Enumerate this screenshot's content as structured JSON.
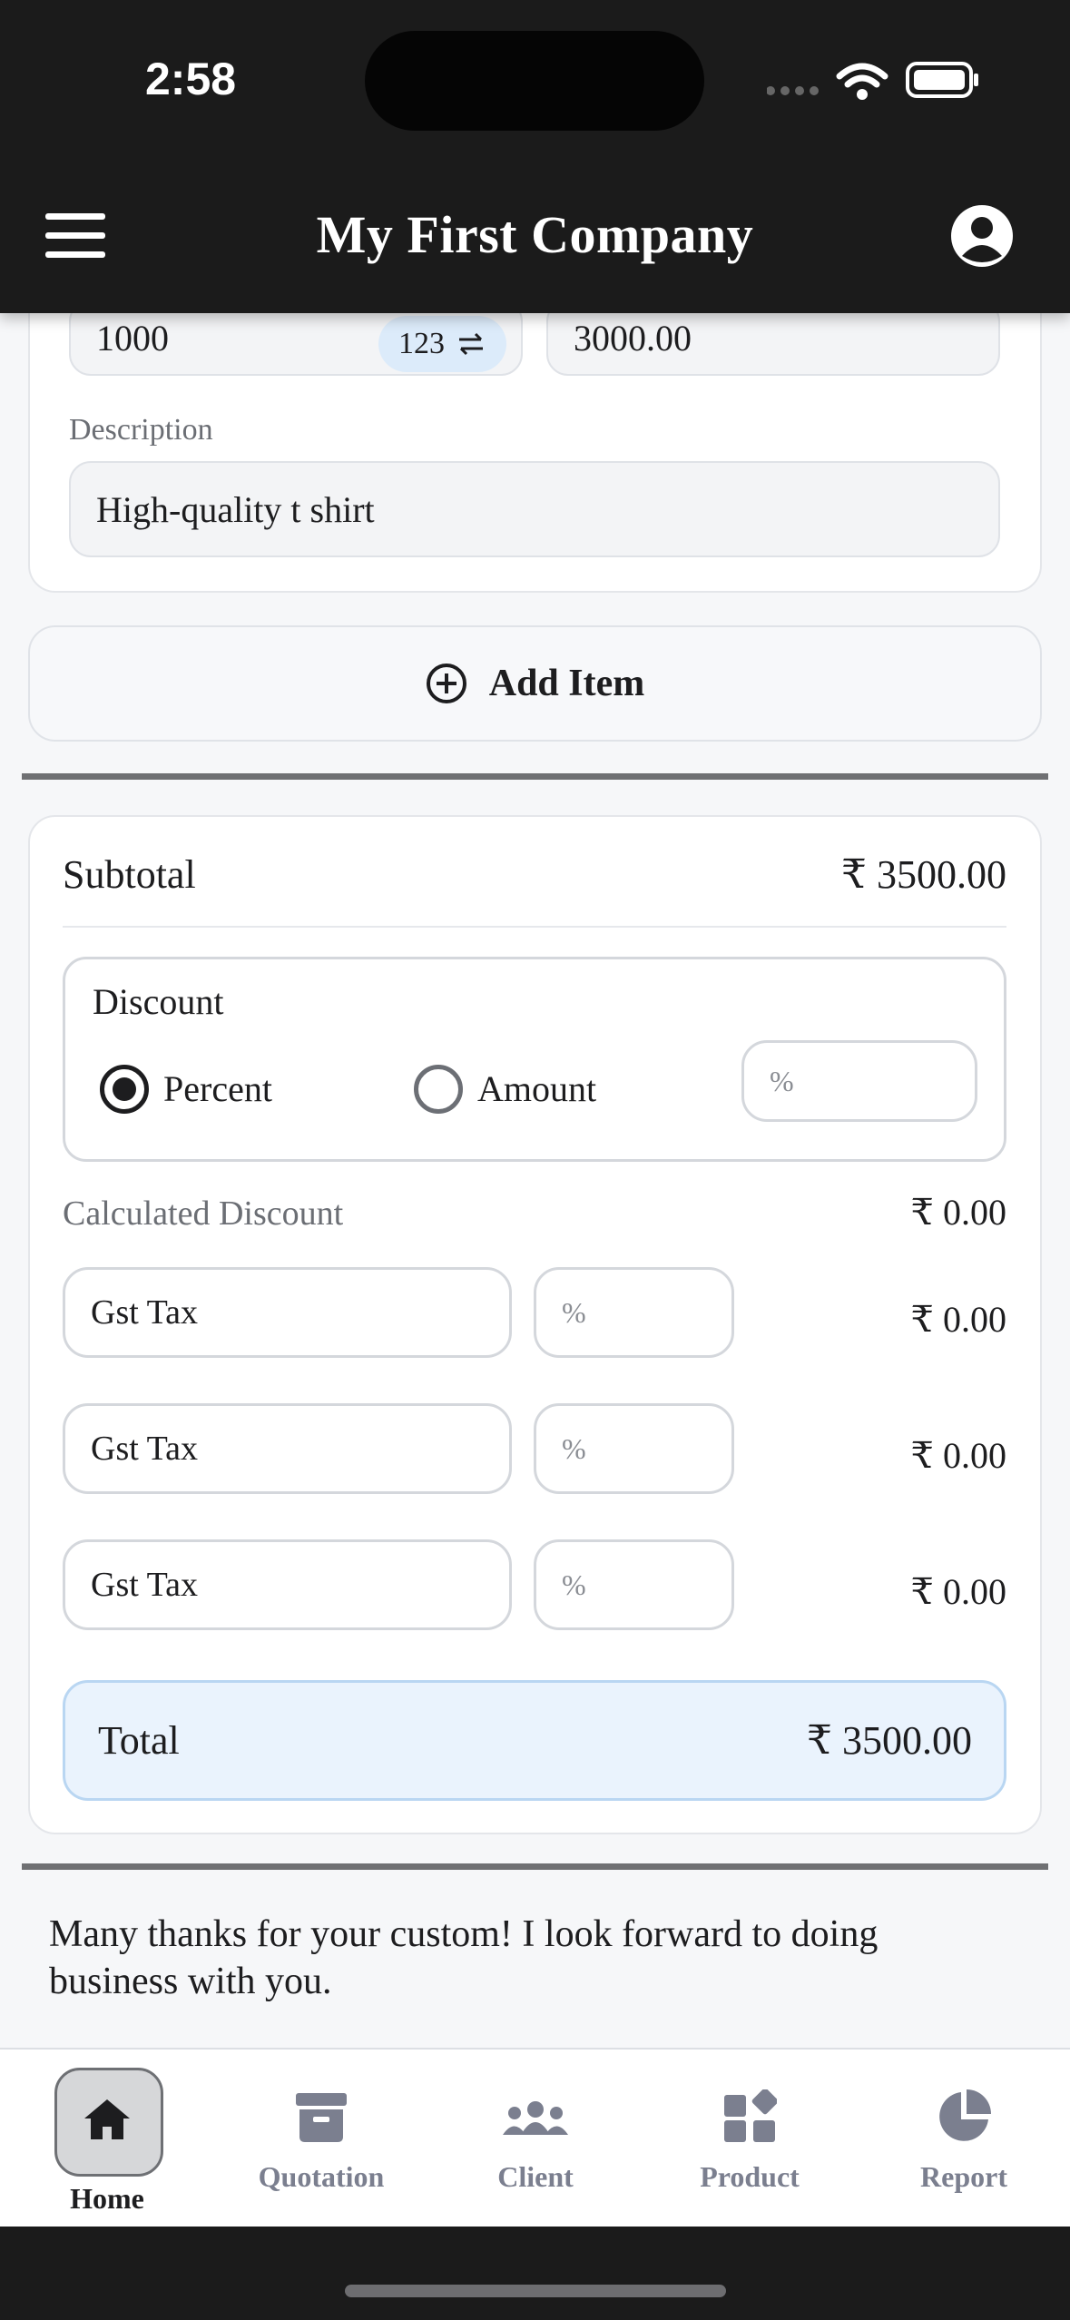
{
  "status_bar": {
    "time": "2:58"
  },
  "header": {
    "title": "My First Company"
  },
  "item": {
    "quantity": "1000",
    "quantity_toggle": "123",
    "amount": "3000.00",
    "description_label": "Description",
    "description": "High-quality t shirt"
  },
  "add_item_label": "Add Item",
  "totals": {
    "subtotal_label": "Subtotal",
    "subtotal_value": "₹ 3500.00",
    "discount_label": "Discount",
    "discount_options": [
      "Percent",
      "Amount"
    ],
    "discount_selected": "Percent",
    "discount_placeholder": "%",
    "calculated_discount_label": "Calculated Discount",
    "calculated_discount_value": "₹ 0.00",
    "taxes": [
      {
        "name": "Gst Tax",
        "placeholder": "%",
        "value": "₹ 0.00"
      },
      {
        "name": "Gst Tax",
        "placeholder": "%",
        "value": "₹ 0.00"
      },
      {
        "name": "Gst Tax",
        "placeholder": "%",
        "value": "₹ 0.00"
      }
    ],
    "total_label": "Total",
    "total_value": "₹ 3500.00"
  },
  "thanks_note": "Many thanks for your custom! I look forward to doing business with you.",
  "bottom_nav": [
    {
      "label": "Home",
      "icon": "home-icon",
      "active": true
    },
    {
      "label": "Quotation",
      "icon": "archive-icon",
      "active": false
    },
    {
      "label": "Client",
      "icon": "users-icon",
      "active": false
    },
    {
      "label": "Product",
      "icon": "shapes-icon",
      "active": false
    },
    {
      "label": "Report",
      "icon": "pie-chart-icon",
      "active": false
    }
  ],
  "colors": {
    "header_bg": "#1b1b1b",
    "total_bg": "#eaf3fd",
    "nav_inactive": "#7b7f8f"
  }
}
